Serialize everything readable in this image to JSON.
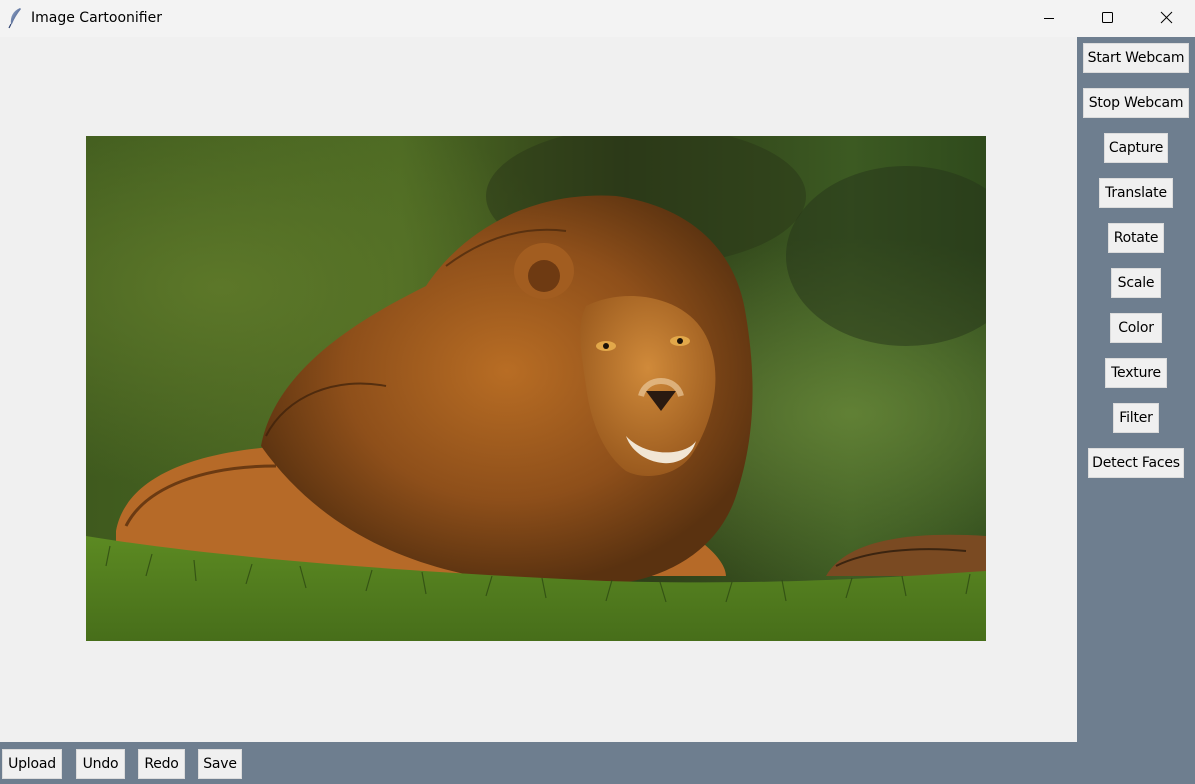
{
  "window": {
    "title": "Image Cartoonifier",
    "app_icon": "feather-icon",
    "controls": [
      "minimize-icon",
      "maximize-icon",
      "close-icon"
    ]
  },
  "canvas": {
    "image": "lion lying in grass, cartoonified"
  },
  "right_panel": {
    "buttons": [
      {
        "label": "Start Webcam"
      },
      {
        "label": "Stop Webcam"
      },
      {
        "label": "Capture"
      },
      {
        "label": "Translate"
      },
      {
        "label": "Rotate"
      },
      {
        "label": "Scale"
      },
      {
        "label": "Color"
      },
      {
        "label": "Texture"
      },
      {
        "label": "Filter"
      },
      {
        "label": "Detect Faces"
      }
    ]
  },
  "bottom_panel": {
    "buttons": [
      {
        "label": "Upload"
      },
      {
        "label": "Undo"
      },
      {
        "label": "Redo"
      },
      {
        "label": "Save"
      }
    ]
  },
  "colors": {
    "panel_bg": "#6e7e8f",
    "canvas_bg": "#f0f0f0",
    "button_bg": "#f0f0f0"
  }
}
